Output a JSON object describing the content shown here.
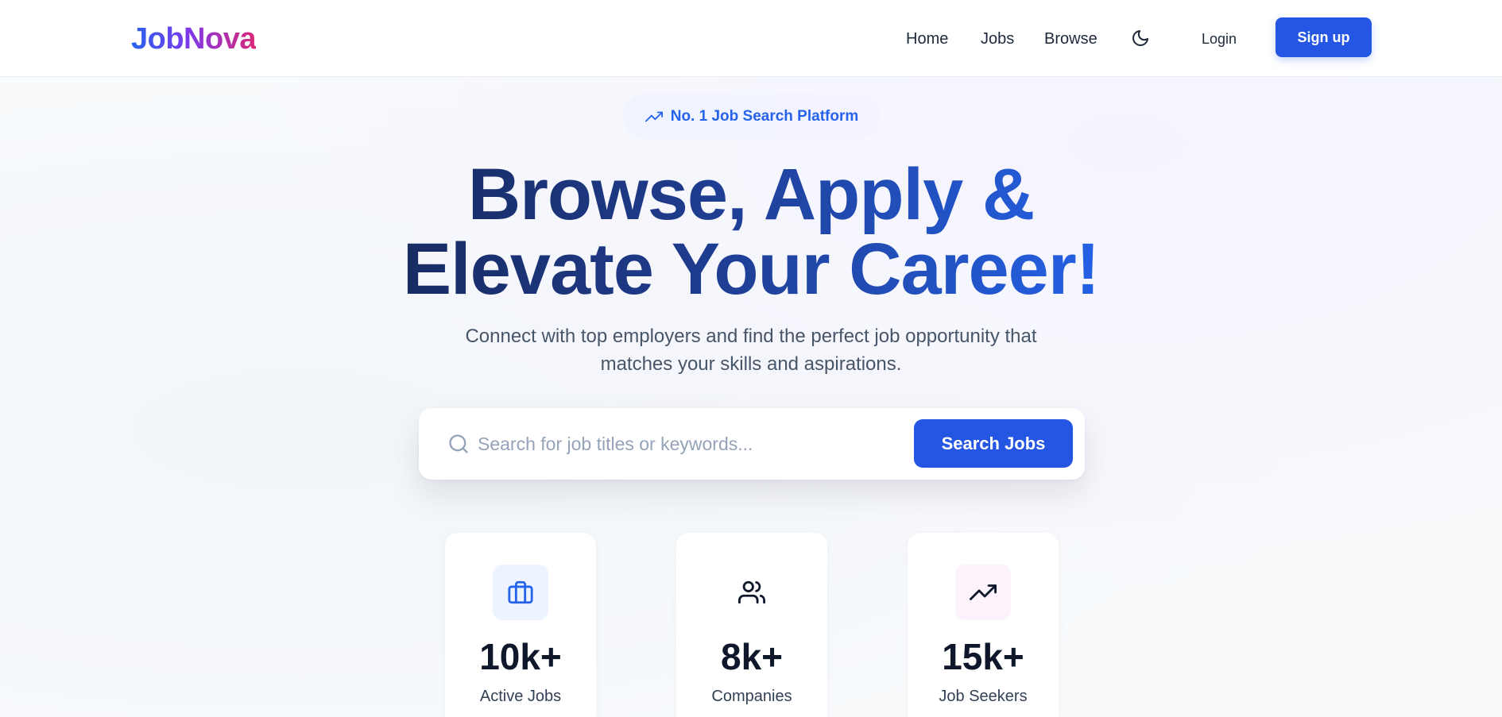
{
  "brand": {
    "name": "JobNova"
  },
  "nav": {
    "items": [
      {
        "label": "Home"
      },
      {
        "label": "Jobs"
      },
      {
        "label": "Browse"
      }
    ],
    "theme_toggle_icon": "moon-icon",
    "login_label": "Login",
    "signup_label": "Sign up"
  },
  "hero": {
    "badge": {
      "icon": "trending-up-icon",
      "text": "No. 1 Job Search Platform"
    },
    "title_line1": "Browse, Apply &",
    "title_line2": "Elevate Your Career!",
    "subtitle": "Connect with top employers and find the perfect job opportunity that matches your skills and aspirations."
  },
  "search": {
    "icon": "search-icon",
    "placeholder": "Search for job titles or keywords...",
    "value": "",
    "button_label": "Search Jobs"
  },
  "stats": [
    {
      "icon": "briefcase-icon",
      "value": "10k+",
      "label": "Active Jobs"
    },
    {
      "icon": "users-icon",
      "value": "8k+",
      "label": "Companies"
    },
    {
      "icon": "trending-up-icon",
      "value": "15k+",
      "label": "Job Seekers"
    }
  ],
  "colors": {
    "primary": "#2456e3",
    "brand_gradient_start": "#2563eb",
    "brand_gradient_end": "#db2777",
    "text_dark": "#0f172a",
    "text_muted": "#475569",
    "background": "#f8fafc"
  }
}
